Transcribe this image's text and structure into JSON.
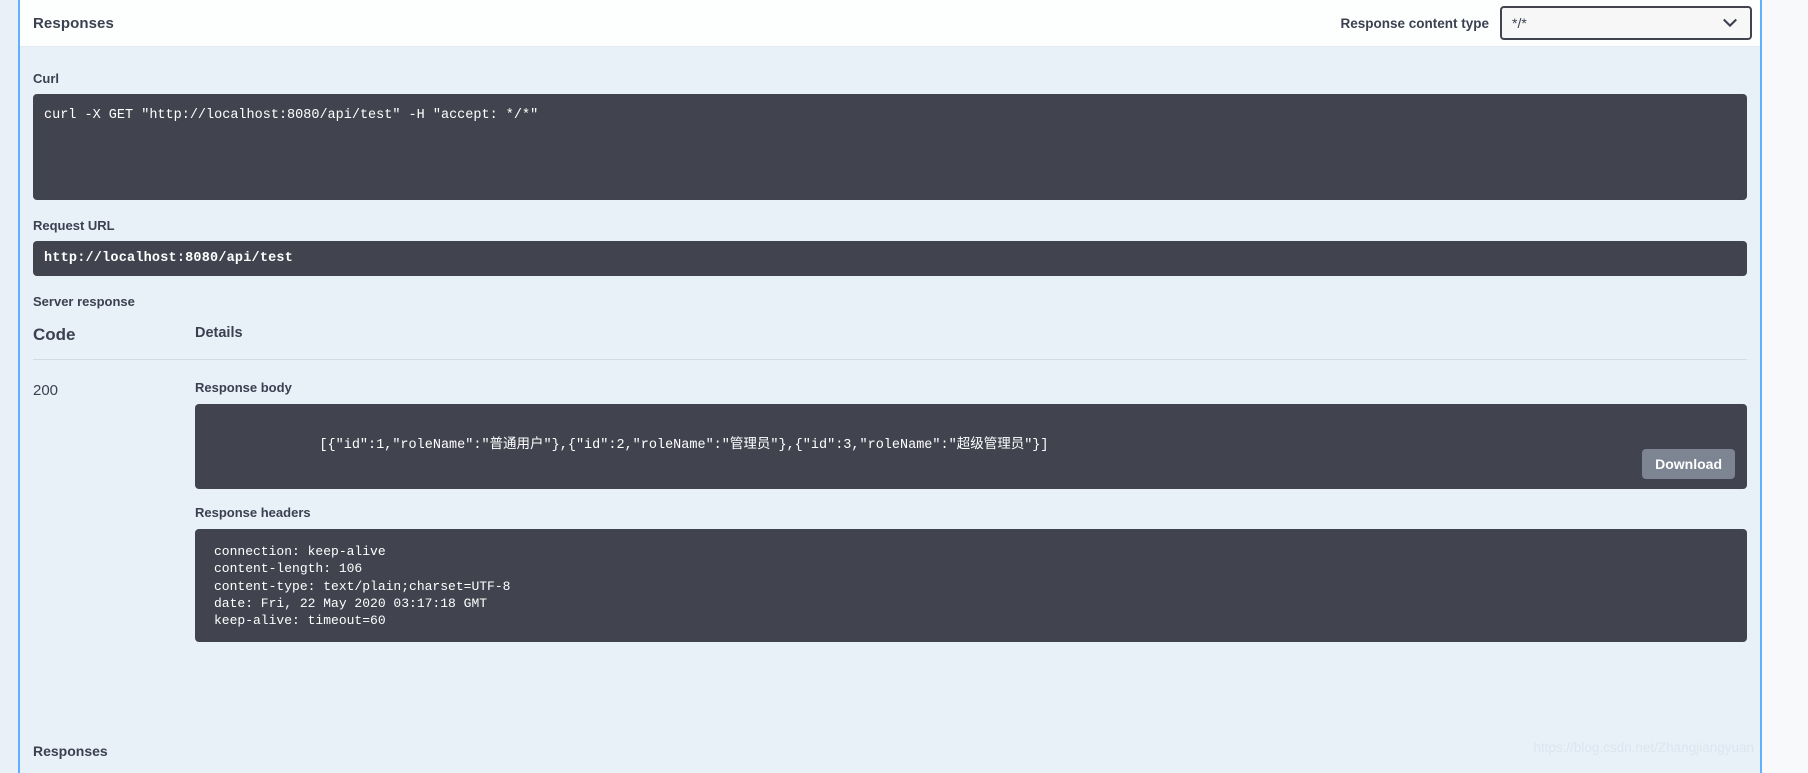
{
  "header": {
    "title": "Responses",
    "content_type_label": "Response content type",
    "content_type_value": "*/*",
    "chevron_icon": "chevron-down-icon"
  },
  "curl": {
    "label": "Curl",
    "command": "curl -X GET \"http://localhost:8080/api/test\" -H \"accept: */*\""
  },
  "request_url": {
    "label": "Request URL",
    "value": "http://localhost:8080/api/test"
  },
  "server_response": {
    "label": "Server response",
    "columns": {
      "code": "Code",
      "details": "Details"
    },
    "rows": [
      {
        "code": "200",
        "response_body_label": "Response body",
        "response_body": "[{\"id\":1,\"roleName\":\"普通用户\"},{\"id\":2,\"roleName\":\"管理员\"},{\"id\":3,\"roleName\":\"超级管理员\"}]",
        "download_label": "Download",
        "response_headers_label": "Response headers",
        "response_headers": "connection: keep-alive\ncontent-length: 106\ncontent-type: text/plain;charset=UTF-8\ndate: Fri, 22 May 2020 03:17:18 GMT\nkeep-alive: timeout=60"
      }
    ]
  },
  "footer": {
    "responses_label": "Responses",
    "watermark": "https://blog.csdn.net/Zhangjiangyuan"
  },
  "colors": {
    "panel_border": "#61affe",
    "code_bg": "#41444e",
    "body_bg": "#e8f0f8",
    "text": "#3b4151",
    "download_btn": "#7d8492"
  }
}
